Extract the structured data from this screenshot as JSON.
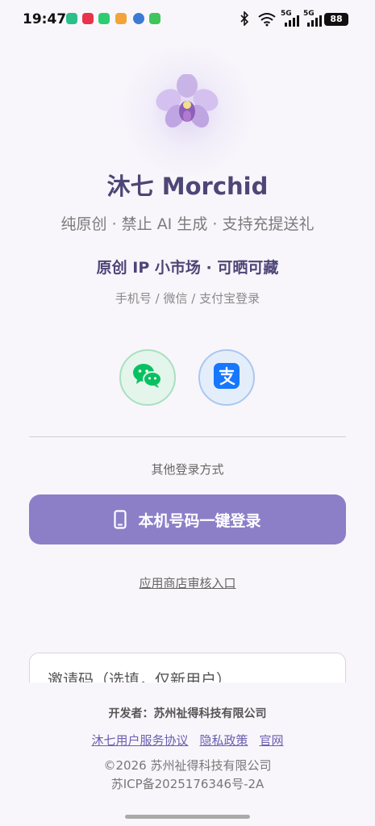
{
  "status_bar": {
    "time": "19:47",
    "battery": "88",
    "notification_icons": [
      {
        "name": "app-notification-icon",
        "color": "#2bbf8a"
      },
      {
        "name": "music-notification-icon",
        "color": "#e8334a"
      },
      {
        "name": "app-notification-icon",
        "color": "#2ecc71"
      },
      {
        "name": "app-notification-icon",
        "color": "#f2a33a"
      },
      {
        "name": "browser-notification-icon",
        "color": "#3a7bd5"
      },
      {
        "name": "phone-notification-icon",
        "color": "#3ec65c"
      }
    ],
    "network_1": "5G",
    "network_2": "5G"
  },
  "app": {
    "title": "沐七 Morchid",
    "tagline": "纯原创 · 禁止 AI 生成 · 支持充提送礼",
    "subheading": "原创 IP 小市场 · 可晒可藏",
    "login_methods": "手机号 / 微信 / 支付宝登录"
  },
  "social_login": {
    "wechat_icon": "wechat-icon",
    "alipay_icon": "alipay-icon",
    "other_label": "其他登录方式"
  },
  "phone_login": {
    "label": "本机号码一键登录",
    "icon": "phone-icon"
  },
  "store_review_link": "应用商店审核入口",
  "invite_field": {
    "placeholder": "邀请码（选填，仅新用户）"
  },
  "footer": {
    "developer": "开发者：苏州祉得科技有限公司",
    "links": [
      "沐七用户服务协议",
      "隐私政策",
      "官网"
    ],
    "copyright": "©2026 苏州祉得科技有限公司",
    "icp": "苏ICP备2025176346号-2A"
  },
  "colors": {
    "primary": "#8c7fc8",
    "title": "#4d4676",
    "background": "#f8f6fb",
    "wechat": "#07c160",
    "alipay": "#1677ff"
  }
}
